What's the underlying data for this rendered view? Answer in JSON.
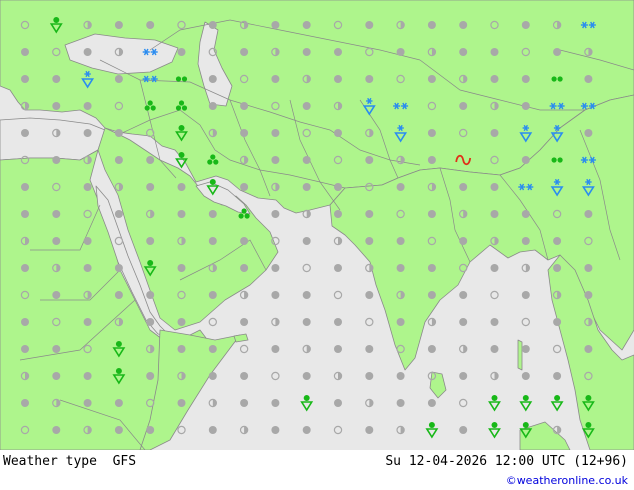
{
  "footer": {
    "title": "Weather type  GFS",
    "time": "Su 12-04-2026 12:00 UTC (12+96)",
    "credit": "©weatheronline.co.uk"
  },
  "colors": {
    "land": "#aef58c",
    "sea": "#e8e8e8",
    "border": "#8a8a8a",
    "dot": "#a8a8a8",
    "rain": "#18b818",
    "snow": "#2a8cf0",
    "thunder": "#e03018"
  },
  "legend_symbols": {
    "dot": "no significant weather",
    "half-dot": "partly cloudy",
    "ring": "fair",
    "rain-shower": "rain shower",
    "showers": "showers",
    "drizzle": "drizzle",
    "snow": "snow",
    "snow-shower": "snow shower",
    "thunderstorm": "thunderstorm"
  },
  "weather_symbols": [
    {
      "row": 0,
      "col": 1,
      "type": "rain-shower"
    },
    {
      "row": 0,
      "col": 18,
      "type": "snow"
    },
    {
      "row": 1,
      "col": 4,
      "type": "snow"
    },
    {
      "row": 2,
      "col": 2,
      "type": "snow-shower"
    },
    {
      "row": 2,
      "col": 4,
      "type": "snow"
    },
    {
      "row": 2,
      "col": 5,
      "type": "drizzle"
    },
    {
      "row": 2,
      "col": 17,
      "type": "drizzle"
    },
    {
      "row": 3,
      "col": 4,
      "type": "showers"
    },
    {
      "row": 3,
      "col": 5,
      "type": "showers"
    },
    {
      "row": 3,
      "col": 11,
      "type": "snow-shower"
    },
    {
      "row": 3,
      "col": 12,
      "type": "snow"
    },
    {
      "row": 3,
      "col": 17,
      "type": "snow"
    },
    {
      "row": 3,
      "col": 18,
      "type": "snow"
    },
    {
      "row": 4,
      "col": 5,
      "type": "rain-shower"
    },
    {
      "row": 4,
      "col": 12,
      "type": "snow-shower"
    },
    {
      "row": 4,
      "col": 16,
      "type": "snow-shower"
    },
    {
      "row": 4,
      "col": 17,
      "type": "snow-shower"
    },
    {
      "row": 5,
      "col": 5,
      "type": "rain-shower"
    },
    {
      "row": 5,
      "col": 6,
      "type": "showers"
    },
    {
      "row": 5,
      "col": 14,
      "type": "thunderstorm"
    },
    {
      "row": 5,
      "col": 17,
      "type": "drizzle"
    },
    {
      "row": 5,
      "col": 18,
      "type": "snow"
    },
    {
      "row": 6,
      "col": 6,
      "type": "rain-shower"
    },
    {
      "row": 6,
      "col": 16,
      "type": "snow"
    },
    {
      "row": 6,
      "col": 17,
      "type": "snow-shower"
    },
    {
      "row": 6,
      "col": 18,
      "type": "snow-shower"
    },
    {
      "row": 7,
      "col": 7,
      "type": "showers"
    },
    {
      "row": 9,
      "col": 4,
      "type": "rain-shower"
    },
    {
      "row": 12,
      "col": 3,
      "type": "rain-shower"
    },
    {
      "row": 13,
      "col": 3,
      "type": "rain-shower"
    },
    {
      "row": 14,
      "col": 9,
      "type": "rain-shower"
    },
    {
      "row": 14,
      "col": 15,
      "type": "rain-shower"
    },
    {
      "row": 14,
      "col": 16,
      "type": "rain-shower"
    },
    {
      "row": 14,
      "col": 17,
      "type": "rain-shower"
    },
    {
      "row": 14,
      "col": 18,
      "type": "rain-shower"
    },
    {
      "row": 15,
      "col": 13,
      "type": "rain-shower"
    },
    {
      "row": 15,
      "col": 15,
      "type": "rain-shower"
    },
    {
      "row": 15,
      "col": 16,
      "type": "rain-shower"
    },
    {
      "row": 15,
      "col": 18,
      "type": "rain-shower"
    }
  ]
}
